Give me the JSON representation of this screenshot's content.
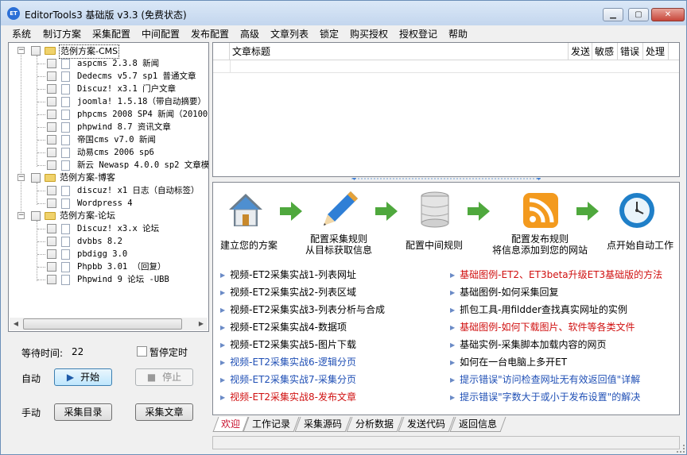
{
  "window": {
    "title": "EditorTools3 基础版 v3.3 (免费状态)",
    "icon_text": "ET",
    "controls": {
      "minimize": "▁",
      "maximize": "▢",
      "close": "✕"
    }
  },
  "menu": [
    "系统",
    "制订方案",
    "采集配置",
    "中间配置",
    "发布配置",
    "高级",
    "文章列表",
    "锁定",
    "购买授权",
    "授权登记",
    "帮助"
  ],
  "tree": {
    "groups": [
      {
        "label": "范例方案-CMS",
        "items": [
          "aspcms 2.3.8 新闻",
          "Dedecms v5.7 sp1 普通文章",
          "Discuz! x3.1 门户文章",
          "joomla! 1.5.18（带自动摘要）",
          "phpcms 2008 SP4 新闻（20100",
          "phpwind 8.7 资讯文章",
          "帝国cms v7.0 新闻",
          "动易cms 2006 sp6",
          "新云 Newasp 4.0.0 sp2 文章模"
        ]
      },
      {
        "label": "范例方案-博客",
        "items": [
          "discuz! x1 日志（自动标签）",
          "Wordpress 4"
        ]
      },
      {
        "label": "范例方案-论坛",
        "items": [
          "Discuz! x3.x 论坛",
          "dvbbs 8.2",
          "pbdigg 3.0",
          "Phpbb 3.01 （回复）",
          "Phpwind 9 论坛 -UBB"
        ]
      }
    ]
  },
  "controls": {
    "wait_label": "等待时间:",
    "wait_value": "22",
    "pause_label": "暂停定时",
    "auto_label": "自动",
    "start_button": "开始",
    "stop_button": "停止",
    "manual_label": "手动",
    "collect_list_button": "采集目录",
    "collect_article_button": "采集文章"
  },
  "grid": {
    "columns": [
      "",
      "文章标题",
      "发送",
      "敏感",
      "错误",
      "处理"
    ]
  },
  "welcome": {
    "flow": [
      {
        "icon": "home-icon",
        "caption": "建立您的方案"
      },
      {
        "icon": "pencil-icon",
        "caption": "配置采集规则\n从目标获取信息"
      },
      {
        "icon": "database-icon",
        "caption": "配置中间规则"
      },
      {
        "icon": "rss-icon",
        "caption": "配置发布规则\n将信息添加到您的网站"
      },
      {
        "icon": "clock-icon",
        "caption": "点开始自动工作"
      }
    ],
    "links_left": [
      {
        "text": "视频-ET2采集实战1-列表网址",
        "color": "#000000"
      },
      {
        "text": "视频-ET2采集实战2-列表区域",
        "color": "#000000"
      },
      {
        "text": "视频-ET2采集实战3-列表分析与合成",
        "color": "#000000"
      },
      {
        "text": "视频-ET2采集实战4-数据项",
        "color": "#000000"
      },
      {
        "text": "视频-ET2采集实战5-图片下载",
        "color": "#000000"
      },
      {
        "text": "视频-ET2采集实战6-逻辑分页",
        "color": "#1f4fb5"
      },
      {
        "text": "视频-ET2采集实战7-采集分页",
        "color": "#1f4fb5"
      },
      {
        "text": "视频-ET2采集实战8-发布文章",
        "color": "#d01010"
      }
    ],
    "links_right": [
      {
        "text": "基础图例-ET2、ET3beta升级ET3基础版的方法",
        "color": "#d01010"
      },
      {
        "text": "基础图例-如何采集回复",
        "color": "#000000"
      },
      {
        "text": "抓包工具-用fildder查找真实网址的实例",
        "color": "#000000"
      },
      {
        "text": "基础图例-如何下载图片、软件等各类文件",
        "color": "#d01010"
      },
      {
        "text": "基础实例-采集脚本加载内容的网页",
        "color": "#000000"
      },
      {
        "text": "如何在一台电脑上多开ET",
        "color": "#000000"
      },
      {
        "text": "提示错误\"访问检查网址无有效返回值\"详解",
        "color": "#1f4fb5"
      },
      {
        "text": "提示错误\"字数大于或小于发布设置\"的解决",
        "color": "#1f4fb5"
      }
    ]
  },
  "tabs": [
    "欢迎",
    "工作记录",
    "采集源码",
    "分析数据",
    "发送代码",
    "返回信息"
  ]
}
